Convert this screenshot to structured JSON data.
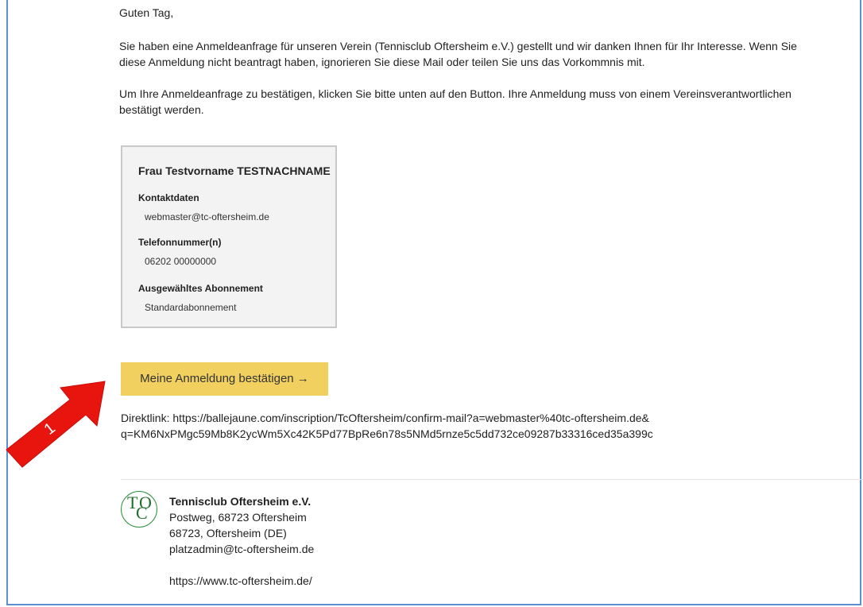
{
  "email": {
    "greeting": "Guten Tag,",
    "para1_line1": "Sie haben eine Anmeldeanfrage für unseren Verein (Tennisclub Oftersheim e.V.) gestellt und wir danken Ihnen für Ihr Interesse. Wenn Sie",
    "para1_line2": "diese Anmeldung nicht beantragt haben, ignorieren Sie diese Mail oder teilen Sie uns das Vorkommnis mit.",
    "para2_line1": "Um Ihre Anmeldeanfrage zu bestätigen, klicken Sie bitte unten auf den Button. Ihre Anmeldung muss von einem Vereinsverantwortlichen",
    "para2_line2": "bestätigt werden."
  },
  "card": {
    "name": "Frau Testvorname TESTNACHNAME",
    "contact_label": "Kontaktdaten",
    "contact_value": "webmaster@tc-oftersheim.de",
    "phone_label": "Telefonnummer(n)",
    "phone_value": "06202 00000000",
    "subscription_label": "Ausgewähltes Abonnement",
    "subscription_value": "Standardabonnement"
  },
  "confirm_button": {
    "label": "Meine Anmeldung bestätigen →"
  },
  "direct_link": {
    "line1": "Direktlink: https://ballejaune.com/inscription/TcOftersheim/confirm-mail?a=webmaster%40tc-oftersheim.de&",
    "line2": "q=KM6NxPMgc59Mb8K2ycWm5Xc42K5Pd77BpRe6n78s5NMd5rnze5c5dd732ce09287b33316ced35a399c"
  },
  "footer": {
    "club_name": "Tennisclub Oftersheim e.V.",
    "address1": "Postweg, 68723 Oftersheim",
    "address2": "68723, Oftersheim (DE)",
    "email": "platzadmin@tc-oftersheim.de",
    "website": "https://www.tc-oftersheim.de/"
  },
  "annotation": {
    "number": "1",
    "color": "#e8150f"
  },
  "colors": {
    "button": "#f1d060",
    "frame": "#5b8fd0",
    "card_bg": "#f3f3f3",
    "logo_green": "#2f8f3f"
  }
}
